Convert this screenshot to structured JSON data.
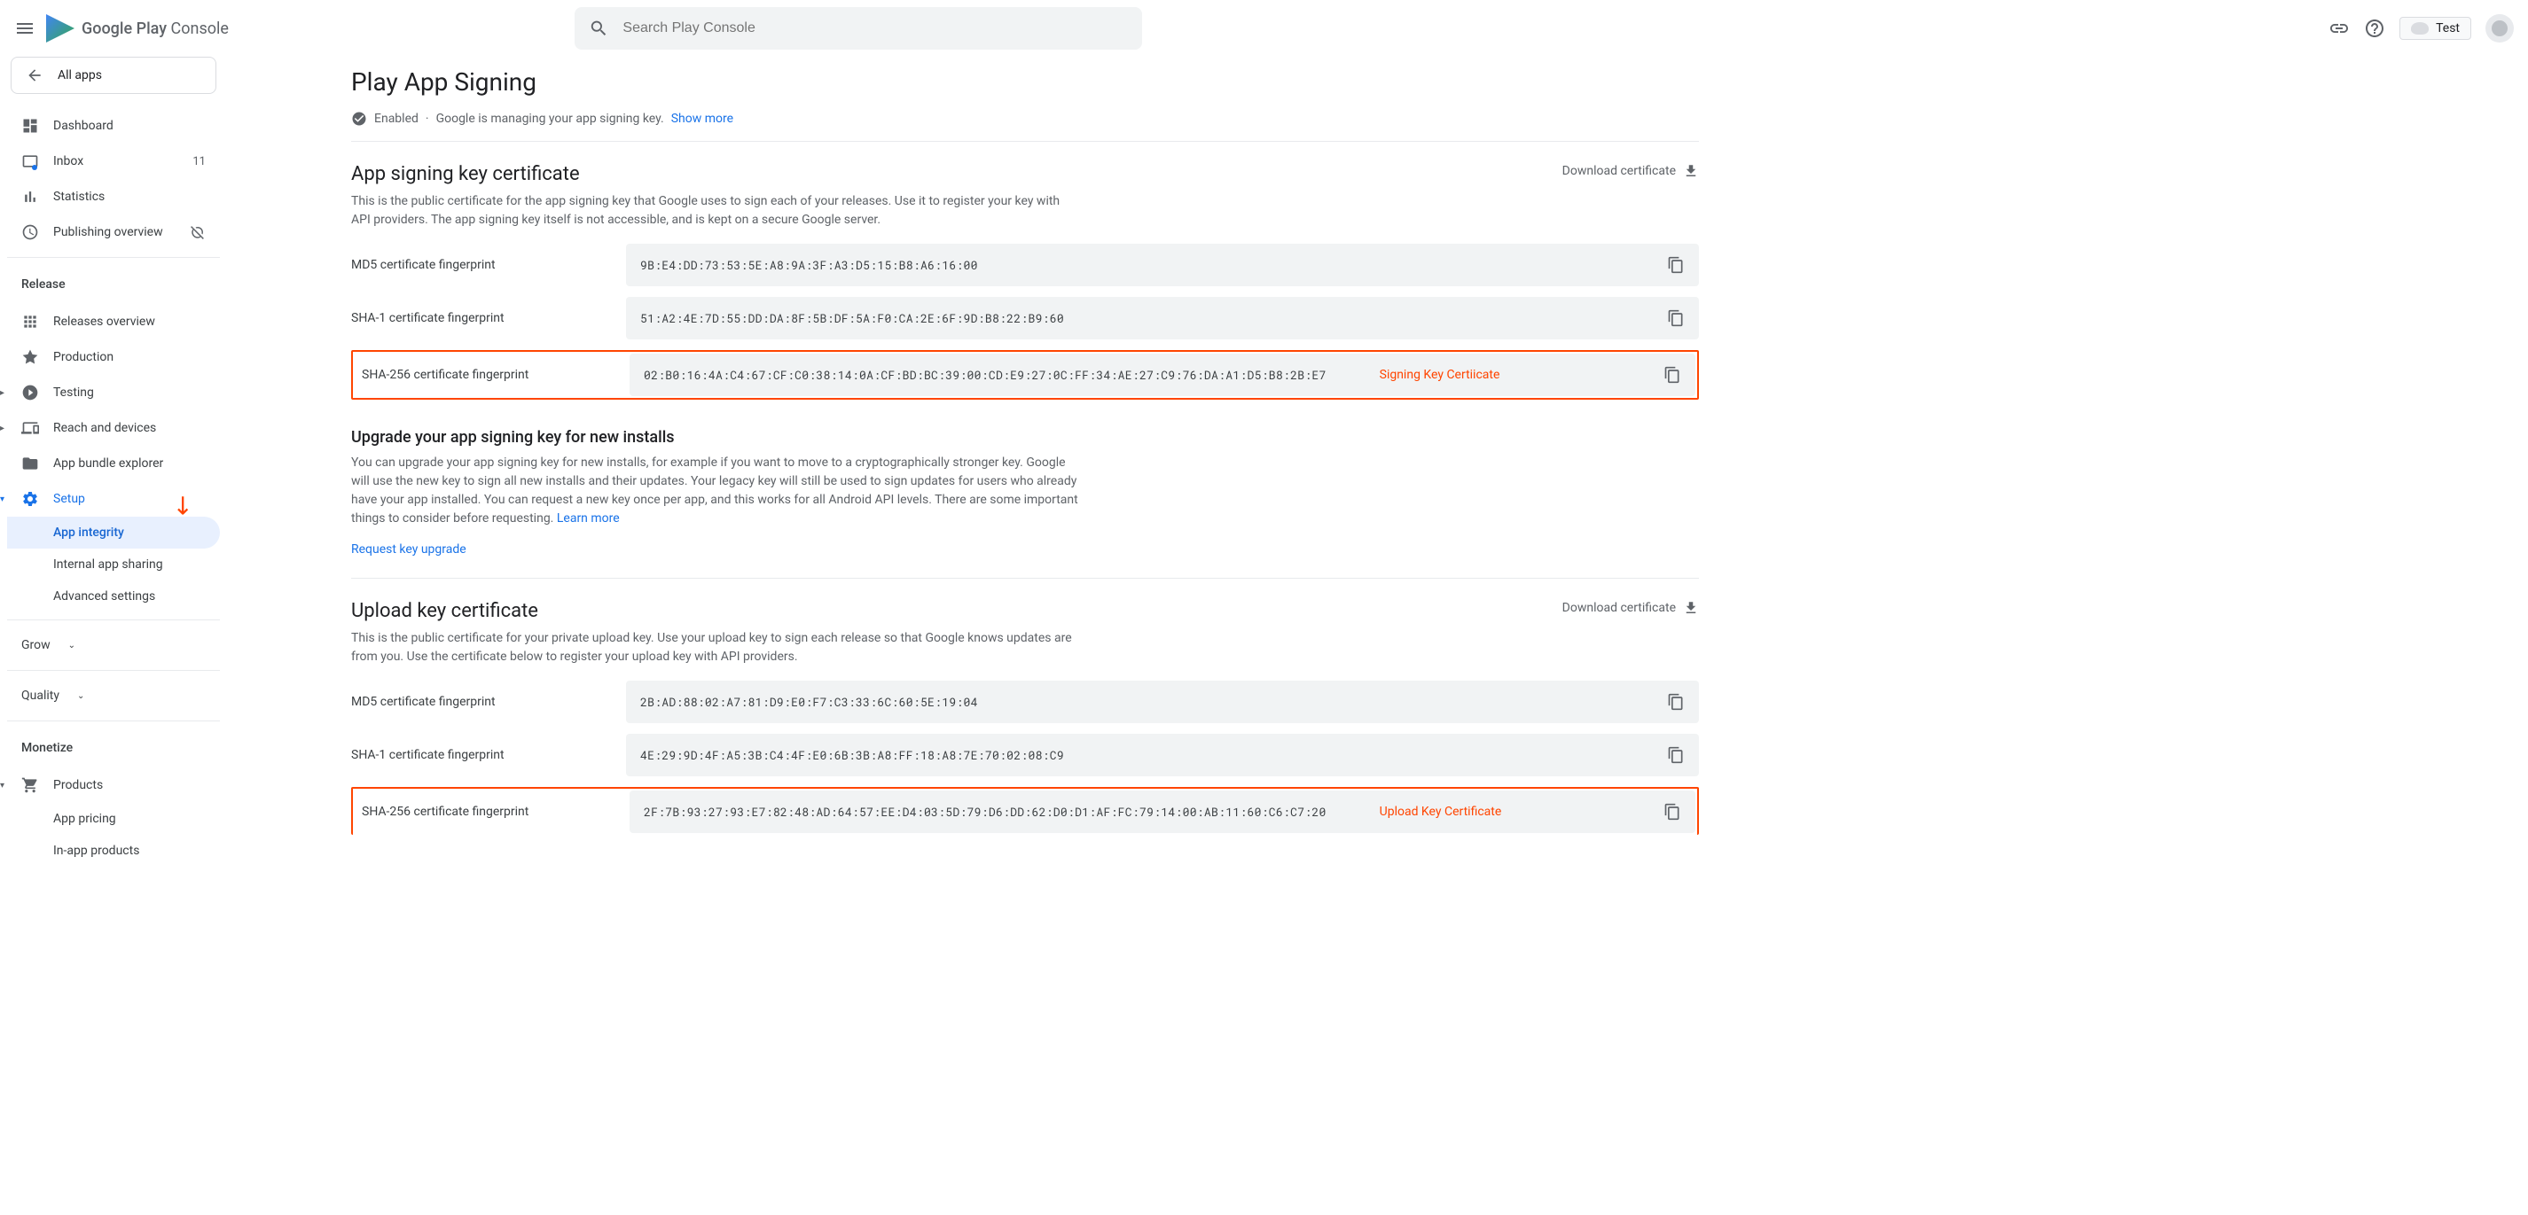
{
  "header": {
    "brand_prefix": "Google Play",
    "brand_suffix": " Console",
    "search_placeholder": "Search Play Console",
    "test_label": "Test"
  },
  "sidebar": {
    "all_apps": "All apps",
    "items": {
      "dashboard": "Dashboard",
      "inbox": "Inbox",
      "inbox_count": "11",
      "statistics": "Statistics",
      "publishing": "Publishing overview"
    },
    "release_section": "Release",
    "release": {
      "overview": "Releases overview",
      "production": "Production",
      "testing": "Testing",
      "reach": "Reach and devices",
      "bundle": "App bundle explorer",
      "setup": "Setup",
      "app_integrity": "App integrity",
      "internal_sharing": "Internal app sharing",
      "advanced": "Advanced settings"
    },
    "grow_section": "Grow",
    "quality_section": "Quality",
    "monetize_section": "Monetize",
    "monetize": {
      "products": "Products",
      "app_pricing": "App pricing",
      "in_app": "In-app products"
    }
  },
  "main": {
    "title": "Play App Signing",
    "status_enabled": "Enabled",
    "status_desc": "Google is managing your app signing key.",
    "show_more": "Show more",
    "signing": {
      "title": "App signing key certificate",
      "desc": "This is the public certificate for the app signing key that Google uses to sign each of your releases. Use it to register your key with API providers. The app signing key itself is not accessible, and is kept on a secure Google server.",
      "download": "Download certificate",
      "md5_label": "MD5 certificate fingerprint",
      "md5_value": "9B:E4:DD:73:53:5E:A8:9A:3F:A3:D5:15:B8:A6:16:00",
      "sha1_label": "SHA-1 certificate fingerprint",
      "sha1_value": "51:A2:4E:7D:55:DD:DA:8F:5B:DF:5A:F0:CA:2E:6F:9D:B8:22:B9:60",
      "sha256_label": "SHA-256 certificate fingerprint",
      "sha256_value": "02:B0:16:4A:C4:67:CF:C0:38:14:0A:CF:BD:BC:39:00:CD:E9:27:0C:FF:34:AE:27:C9:76:DA:A1:D5:B8:2B:E7",
      "annotation": "Signing Key Certiicate"
    },
    "upgrade": {
      "title": "Upgrade your app signing key for new installs",
      "desc": "You can upgrade your app signing key for new installs, for example if you want to move to a cryptographically stronger key. Google will use the new key to sign all new installs and their updates. Your legacy key will still be used to sign updates for users who already have your app installed. You can request a new key once per app, and this works for all Android API levels. There are some important things to consider before requesting.",
      "learn_more": "Learn more",
      "request": "Request key upgrade"
    },
    "upload": {
      "title": "Upload key certificate",
      "desc": "This is the public certificate for your private upload key. Use your upload key to sign each release so that Google knows updates are from you. Use the certificate below to register your upload key with API providers.",
      "download": "Download certificate",
      "md5_label": "MD5 certificate fingerprint",
      "md5_value": "2B:AD:88:02:A7:81:D9:E0:F7:C3:33:6C:60:5E:19:04",
      "sha1_label": "SHA-1 certificate fingerprint",
      "sha1_value": "4E:29:9D:4F:A5:3B:C4:4F:E0:6B:3B:A8:FF:18:A8:7E:70:02:08:C9",
      "sha256_label": "SHA-256 certificate fingerprint",
      "sha256_value": "2F:7B:93:27:93:E7:82:48:AD:64:57:EE:D4:03:5D:79:D6:DD:62:D0:D1:AF:FC:79:14:00:AB:11:60:C6:C7:20",
      "annotation": "Upload Key Certificate"
    }
  }
}
